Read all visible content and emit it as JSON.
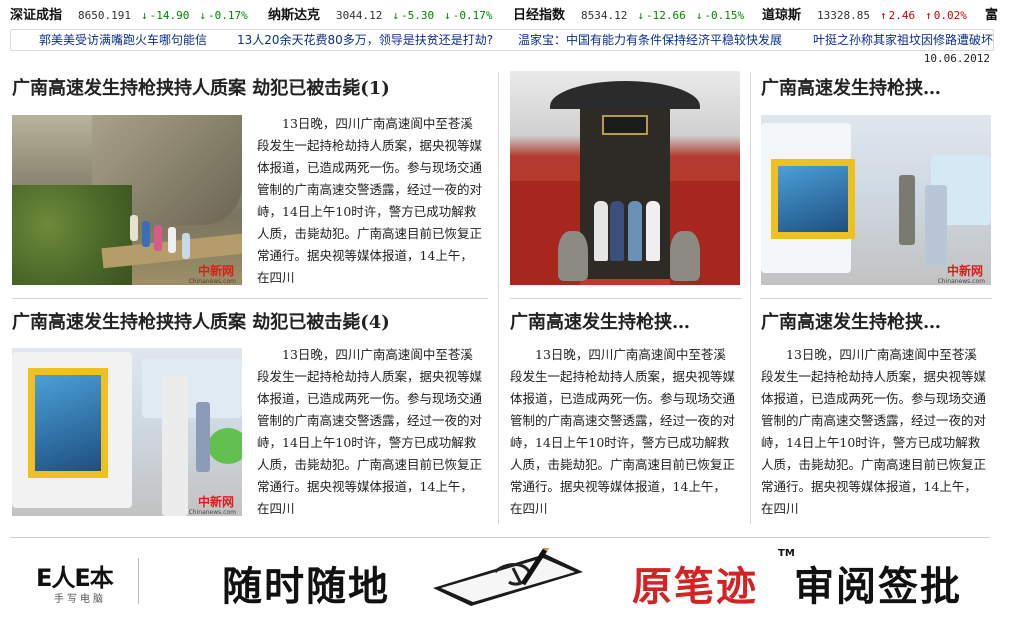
{
  "ticker": [
    {
      "name": "深证成指",
      "value": "8650.191",
      "change": "-14.90",
      "percent": "-0.17%",
      "direction": "down"
    },
    {
      "name": "纳斯达克",
      "value": "3044.12",
      "change": "-5.30",
      "percent": "-0.17%",
      "direction": "down"
    },
    {
      "name": "日经指数",
      "value": "8534.12",
      "change": "-12.66",
      "percent": "-0.15%",
      "direction": "down"
    },
    {
      "name": "道琼斯",
      "value": "13328.85",
      "change": "2.46",
      "percent": "0.02%",
      "direction": "up"
    },
    {
      "name": "富"
    }
  ],
  "headlines": [
    "郭美美受访满嘴跑火车哪句能信",
    "13人20余天花费80多万，领导是扶贫还是打劫?",
    "温家宝：中国有能力有条件保持经济平稳较快发展",
    "叶挺之孙称其家祖坟因修路遭破坏"
  ],
  "date": "10.06.2012",
  "articles": [
    {
      "title": "广南高速发生持枪挟持人质案  劫犯已被击毙(1)",
      "body": "13日晚，四川广南高速阆中至苍溪段发生一起持枪劫持人质案，据央视等媒体报道，已造成两死一伤。参与现场交通管制的广南高速交警透露，经过一夜的对峙，14日上午10时许，警方已成功解救人质，击毙劫犯。广南高速目前已恢复正常通行。据央视等媒体报道，14上午，在四川"
    },
    {
      "title": "",
      "body": ""
    },
    {
      "title": "广南高速发生持枪挟…",
      "body": ""
    },
    {
      "title": "广南高速发生持枪挟持人质案  劫犯已被击毙(4)",
      "body": "13日晚，四川广南高速阆中至苍溪段发生一起持枪劫持人质案，据央视等媒体报道，已造成两死一伤。参与现场交通管制的广南高速交警透露，经过一夜的对峙，14日上午10时许，警方已成功解救人质，击毙劫犯。广南高速目前已恢复正常通行。据央视等媒体报道，14上午，在四川"
    },
    {
      "title": "广南高速发生持枪挟…",
      "body": "13日晚，四川广南高速阆中至苍溪段发生一起持枪劫持人质案，据央视等媒体报道，已造成两死一伤。参与现场交通管制的广南高速交警透露，经过一夜的对峙，14日上午10时许，警方已成功解救人质，击毙劫犯。广南高速目前已恢复正常通行。据央视等媒体报道，14上午，在四川"
    },
    {
      "title": "广南高速发生持枪挟…",
      "body": "13日晚，四川广南高速阆中至苍溪段发生一起持枪劫持人质案，据央视等媒体报道，已造成两死一伤。参与现场交通管制的广南高速交警透露，经过一夜的对峙，14日上午10时许，警方已成功解救人质，击毙劫犯。广南高速目前已恢复正常通行。据央视等媒体报道，14上午，在四川"
    }
  ],
  "photo_watermark": "中新网",
  "photo_watermark_url": "Chinanews.com",
  "ad": {
    "logo": "E人E本",
    "logo_sub": "手写电脑",
    "slogan": "随时随地",
    "brand": "原笔迹",
    "tm": "TM",
    "tagline": "审阅签批"
  },
  "colors": {
    "down": "#008800",
    "up": "#cc0000",
    "link": "#0a2f8f",
    "brand_red": "#d42323"
  }
}
